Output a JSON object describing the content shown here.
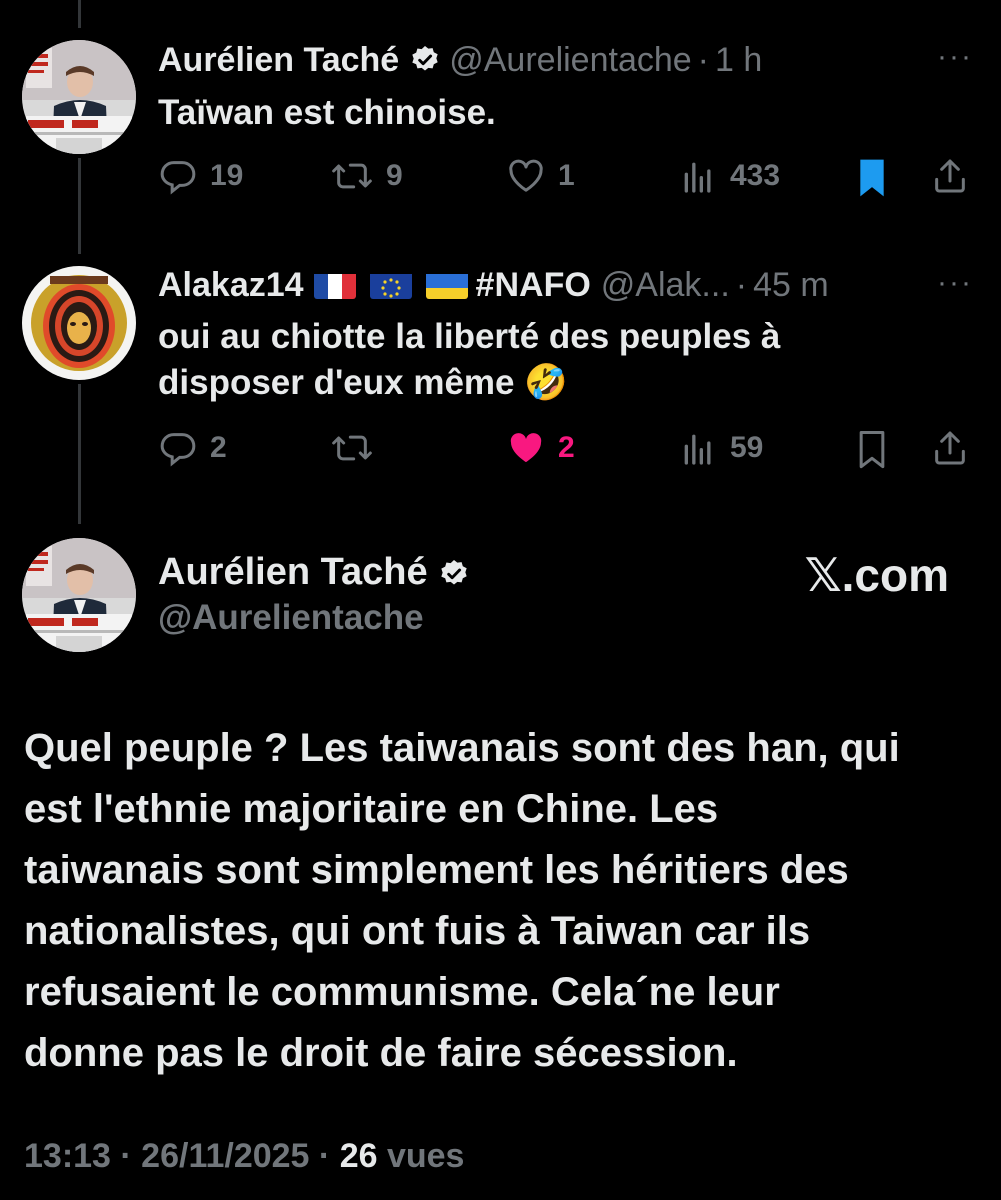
{
  "tweet1": {
    "author": "Aurélien Taché",
    "handle": "@Aurelientache",
    "separator": "·",
    "time": "1 h",
    "text": "Taïwan est chinoise.",
    "more": "···",
    "replies": "19",
    "retweets": "9",
    "likes": "1",
    "views": "433",
    "bookmarked": true
  },
  "tweet2": {
    "author": "Alakaz14",
    "hashtag": "#NAFO",
    "handle": "@Alak...",
    "separator": "·",
    "time": "45 m",
    "text_line1": "oui au chiotte la liberté des peuples à",
    "text_line2": "disposer d'eux même 🤣",
    "more": "···",
    "replies": "2",
    "likes": "2",
    "views": "59",
    "liked": true
  },
  "main": {
    "author": "Aurélien Taché",
    "handle": "@Aurelientache",
    "source": "𝕏.com",
    "text_lines": [
      "Quel peuple ? Les taiwanais sont des han, qui",
      "est l'ethnie majoritaire en Chine. Les",
      "taiwanais sont simplement les héritiers des",
      "nationalistes, qui ont fuis à Taiwan car ils",
      "refusaient le communisme. Cela´ne leur",
      "donne pas le droit de faire sécession."
    ],
    "timestamp": "13:13 · 26/11/2025 · ",
    "views_count": "26",
    "views_label": " vues"
  },
  "colors": {
    "background": "#000000",
    "text": "#e7e9ea",
    "muted": "#71767b",
    "accent": "#1d9bf0",
    "like": "#f91880"
  }
}
